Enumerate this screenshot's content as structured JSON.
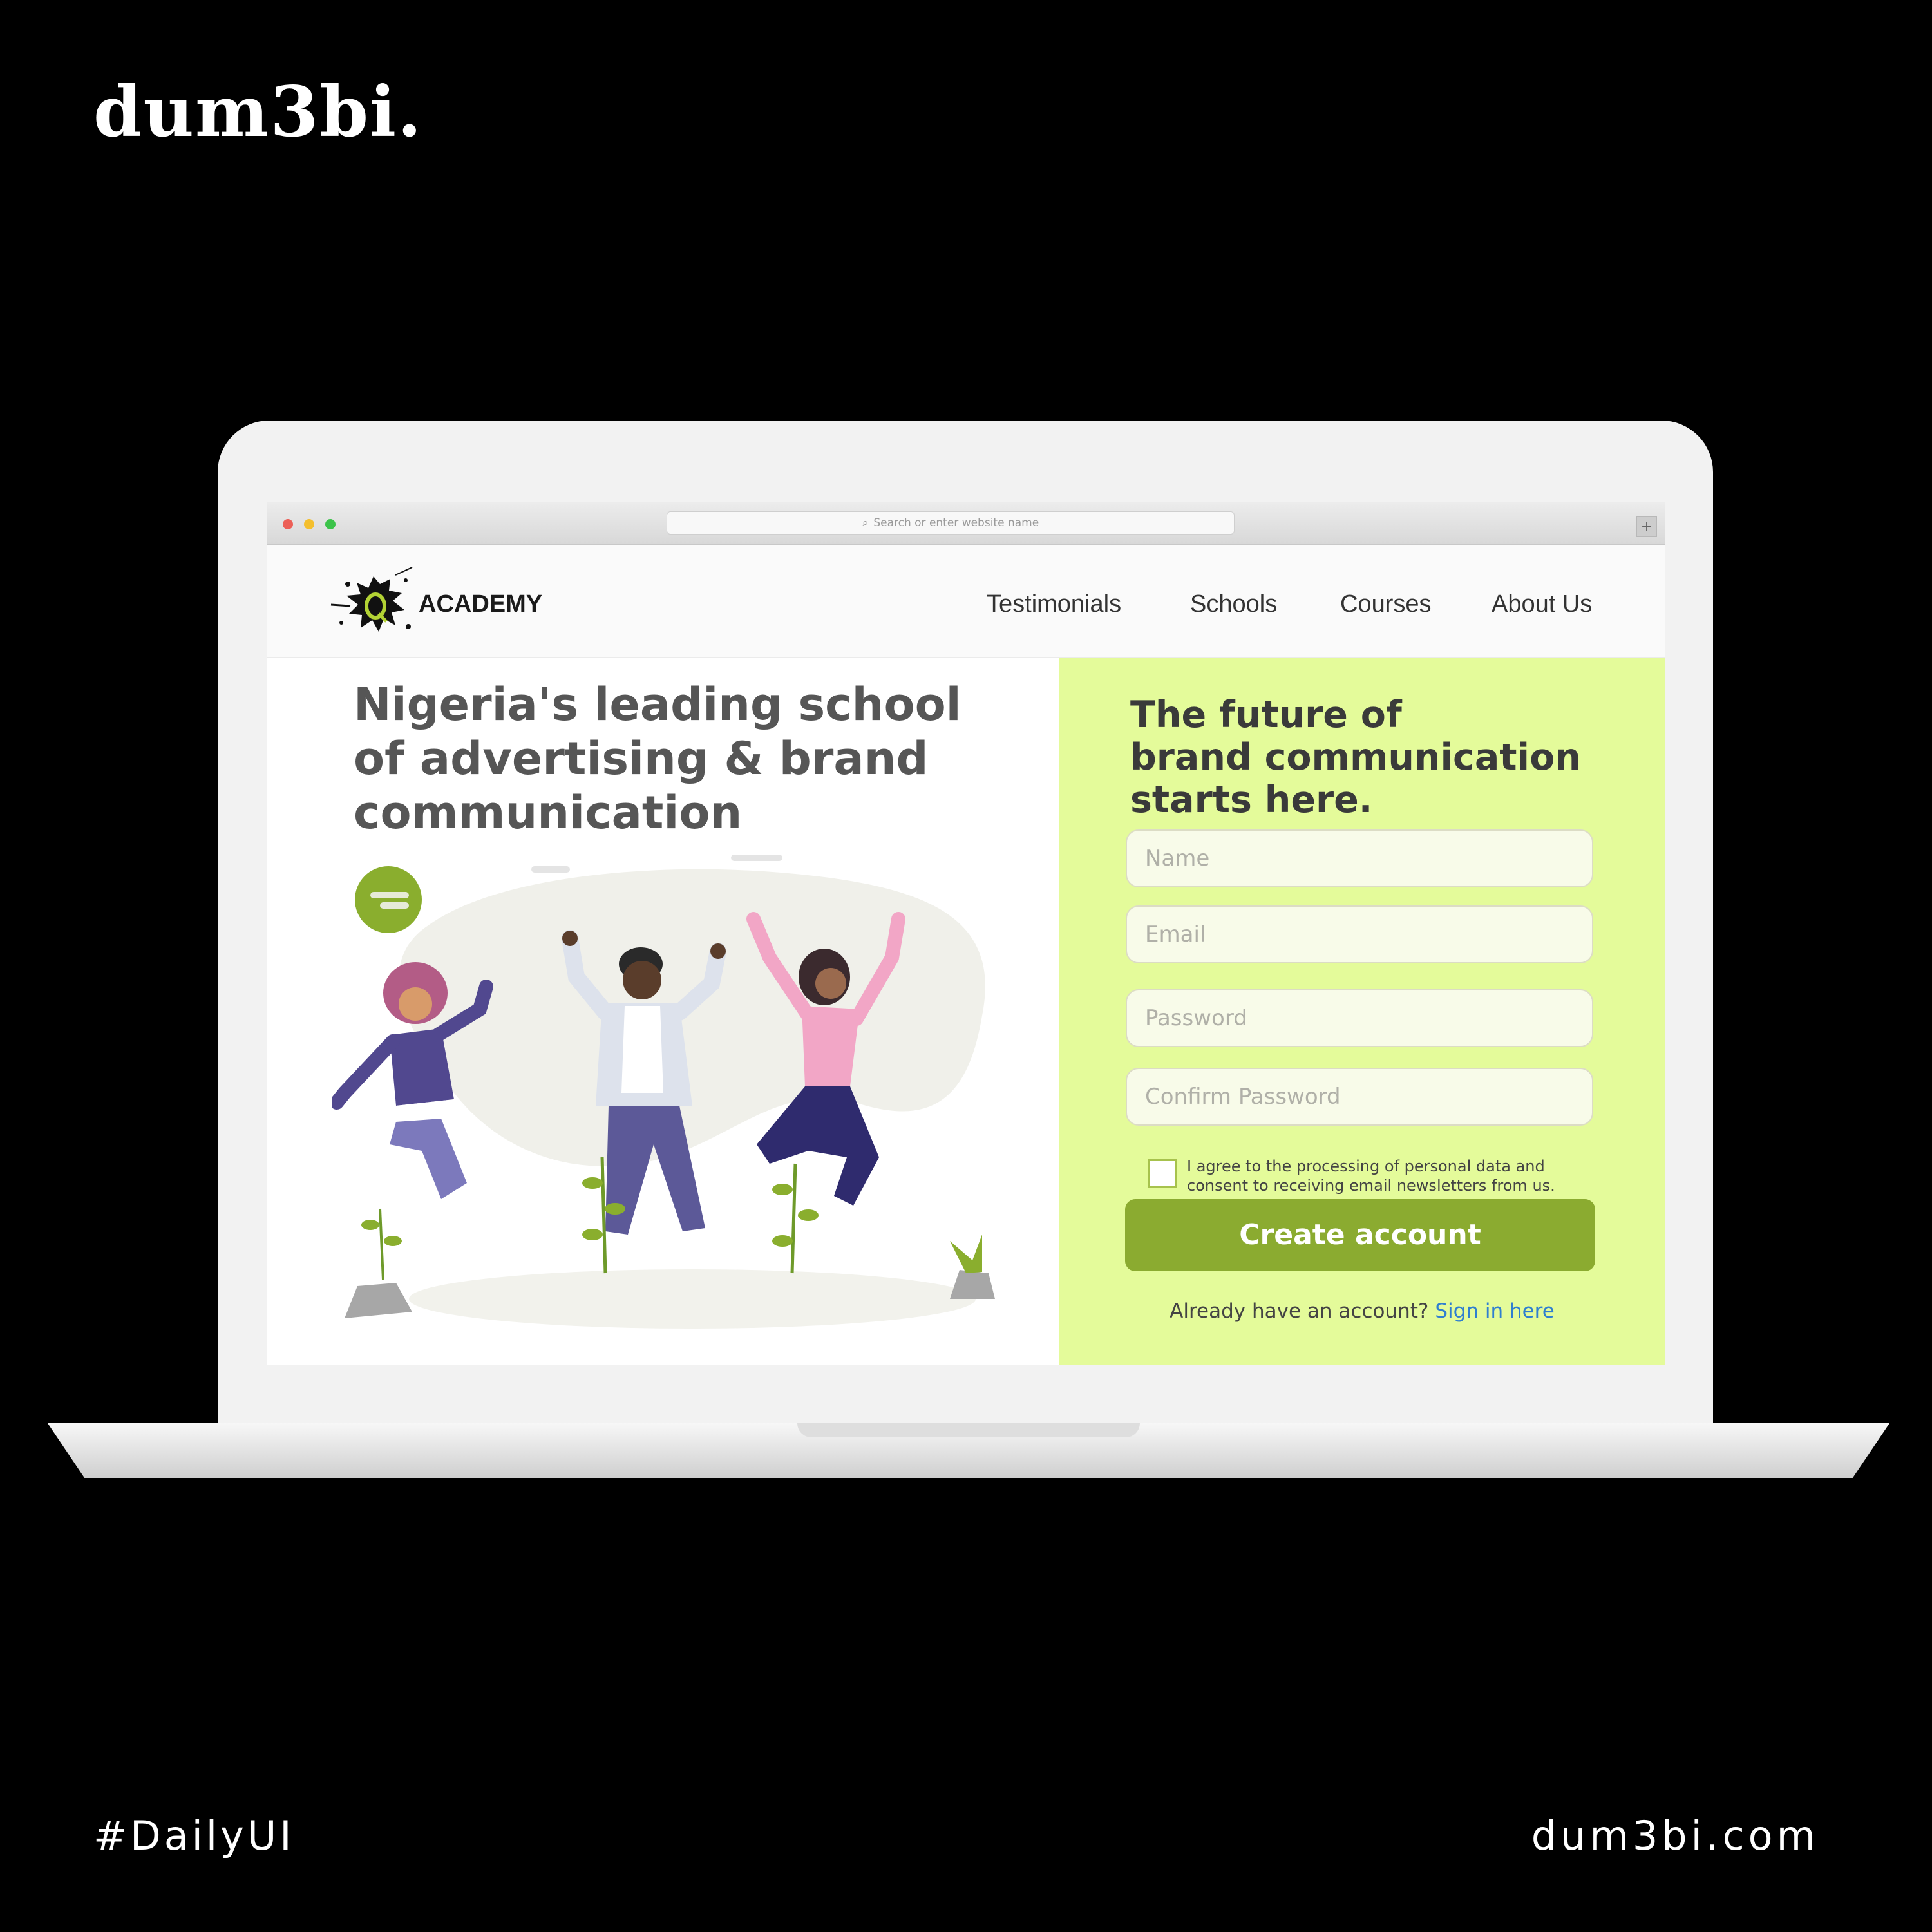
{
  "brand": {
    "logo_text": "dum3bi.",
    "tagline": "#DailyUI",
    "website": "dum3bi.com"
  },
  "browser": {
    "url_placeholder": "Search or enter website name"
  },
  "site": {
    "logo_text": "ACADEMY",
    "nav": [
      "Testimonials",
      "Schools",
      "Courses",
      "About Us"
    ]
  },
  "hero": {
    "title": "Nigeria's leading school of advertising & brand communication"
  },
  "form": {
    "heading_line1": "The future of",
    "heading_line2": "brand communication",
    "heading_line3": "starts here.",
    "name_placeholder": "Name",
    "email_placeholder": "Email",
    "password_placeholder": "Password",
    "confirm_placeholder": "Confirm Password",
    "consent_text": "I agree to the processing of personal data and consent to receiving email newsletters from us.",
    "submit_label": "Create account",
    "signin_prompt": "Already have an account?",
    "signin_link": "Sign in here"
  },
  "colors": {
    "accent": "#8bab30",
    "panel": "#e4fb9a",
    "link": "#2f7fd0"
  }
}
